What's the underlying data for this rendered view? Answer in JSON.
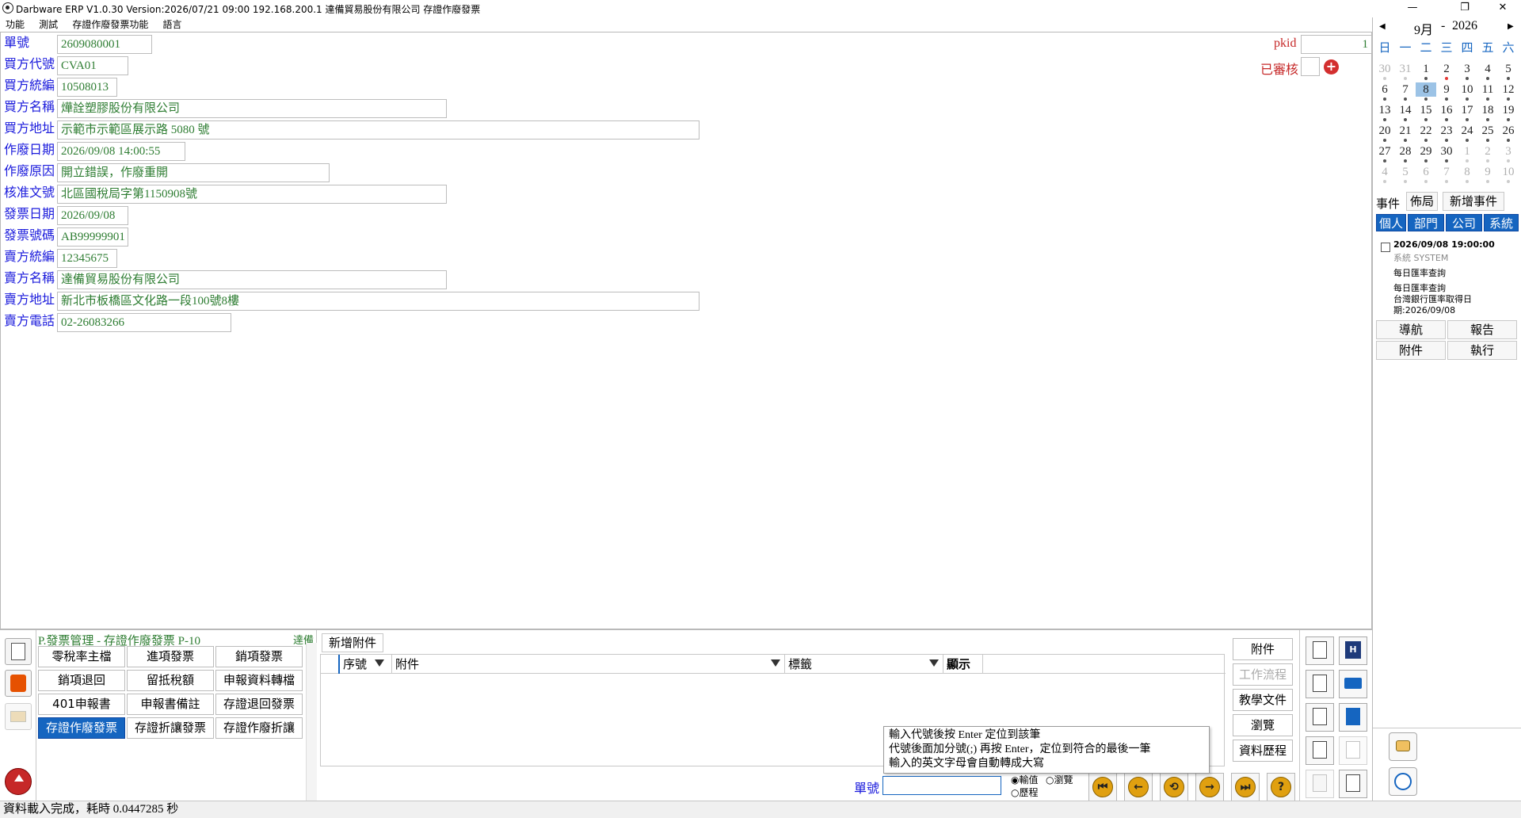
{
  "window": {
    "title": "Darbware ERP V1.0.30 Version:2026/07/21 09:00   192.168.200.1 達備貿易股份有限公司 存證作廢發票",
    "min": "—",
    "restore": "❐",
    "close": "✕"
  },
  "menu": [
    "功能",
    "測試",
    "存證作廢發票功能",
    "語言"
  ],
  "form": {
    "fields": [
      {
        "label": "單號",
        "value": "2609080001"
      },
      {
        "label": "買方代號",
        "value": "CVA01"
      },
      {
        "label": "買方統編",
        "value": "10508013"
      },
      {
        "label": "買方名稱",
        "value": "燁詮塑膠股份有限公司"
      },
      {
        "label": "買方地址",
        "value": "示範市示範區展示路 5080 號"
      },
      {
        "label": "作廢日期",
        "value": "2026/09/08 14:00:55"
      },
      {
        "label": "作廢原因",
        "value": "開立錯誤，作廢重開"
      },
      {
        "label": "核准文號",
        "value": "北區國稅局字第1150908號"
      },
      {
        "label": "發票日期",
        "value": "2026/09/08"
      },
      {
        "label": "發票號碼",
        "value": "AB99999901"
      },
      {
        "label": "賣方統編",
        "value": "12345675"
      },
      {
        "label": "賣方名稱",
        "value": "達備貿易股份有限公司"
      },
      {
        "label": "賣方地址",
        "value": "新北市板橋區文化路一段100號8樓"
      },
      {
        "label": "賣方電話",
        "value": "02-26083266"
      }
    ],
    "pkid_label": "pkid",
    "pkid_value": "1",
    "audited_label": "已審核",
    "add_icon": "plus-circle-icon"
  },
  "calendar": {
    "month": "9月",
    "separator": "-",
    "year": "2026",
    "prev": "◀",
    "next": "▶",
    "weekdays": [
      "日",
      "一",
      "二",
      "三",
      "四",
      "五",
      "六"
    ],
    "weeks": [
      [
        "30",
        "31",
        "1",
        "2",
        "3",
        "4",
        "5"
      ],
      [
        "6",
        "7",
        "8",
        "9",
        "10",
        "11",
        "12"
      ],
      [
        "13",
        "14",
        "15",
        "16",
        "17",
        "18",
        "19"
      ],
      [
        "20",
        "21",
        "22",
        "23",
        "24",
        "25",
        "26"
      ],
      [
        "27",
        "28",
        "29",
        "30",
        "1",
        "2",
        "3"
      ],
      [
        "4",
        "5",
        "6",
        "7",
        "8",
        "9",
        "10"
      ]
    ],
    "selected": "8"
  },
  "events": {
    "tab_label": "事件",
    "layout_button": "佈局",
    "add_event_button": "新增事件",
    "filters": [
      "個人",
      "部門",
      "公司",
      "系統"
    ],
    "item": {
      "time": "2026/09/08 19:00:00",
      "source": "系統  SYSTEM",
      "title": "每日匯率查詢",
      "desc_line1": "每日匯率查詢",
      "desc_line2": "台灣銀行匯率取得日",
      "desc_line3": "期:2026/09/08"
    },
    "buttons": [
      "導航",
      "報告",
      "附件",
      "執行"
    ]
  },
  "bottom": {
    "module_title": "P.發票管理 - 存證作廢發票  P-10",
    "company_short": "達備",
    "grid": [
      [
        "零稅率主檔",
        "進項發票",
        "銷項發票"
      ],
      [
        "銷項退回",
        "留抵稅額",
        "申報資料轉檔"
      ],
      [
        "401申報書",
        "申報書備註",
        "存證退回發票"
      ],
      [
        "存證作廢發票",
        "存證折讓發票",
        "存證作廢折讓"
      ]
    ],
    "attachment_tab": "新增附件",
    "columns": [
      "序號",
      "附件",
      "標籤",
      "顯示"
    ],
    "side_buttons": [
      "附件",
      "工作流程",
      "教學文件",
      "瀏覽",
      "資料歷程"
    ],
    "tooltip": [
      "輸入代號後按 Enter 定位到該筆",
      "代號後面加分號(;) 再按 Enter，定位到符合的最後一筆",
      "輸入的英文字母會自動轉成大寫"
    ],
    "search_label": "單號",
    "search_value": "",
    "radio_options": [
      "輸值",
      "瀏覽",
      "歷程"
    ],
    "nav": [
      "⏮",
      "←",
      "⟲",
      "→",
      "⏭",
      "?"
    ]
  },
  "status": "資料載入完成，耗時 0.0447285 秒"
}
